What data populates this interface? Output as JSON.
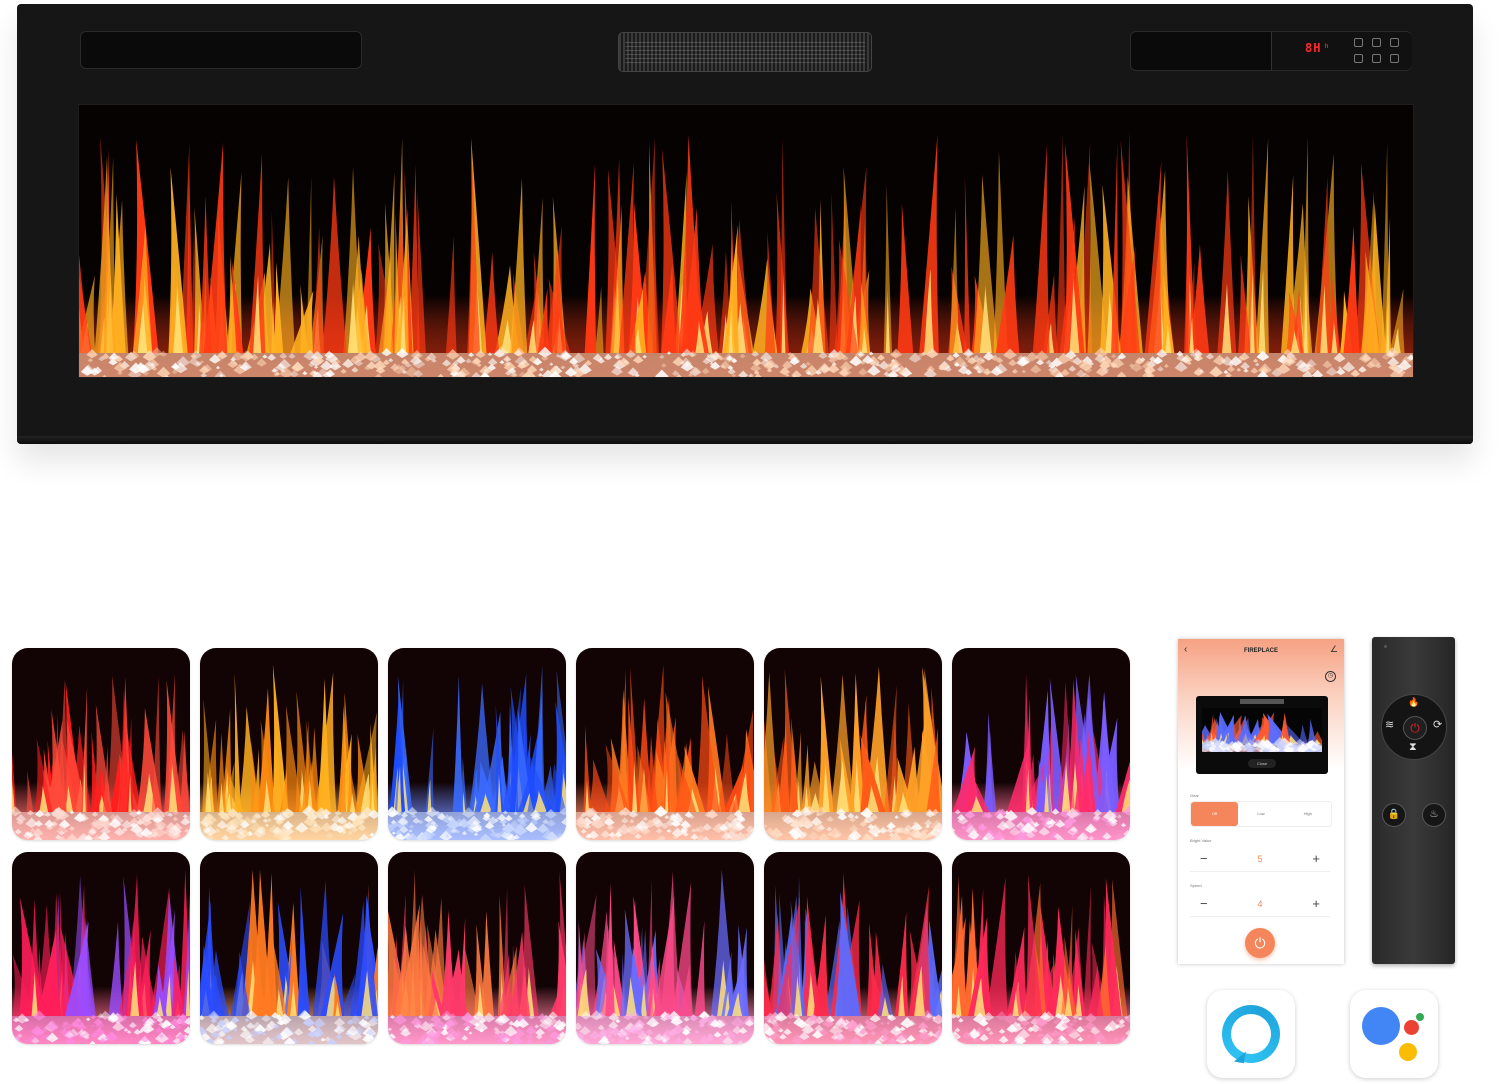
{
  "fireplace": {
    "display_text": "8H",
    "display_unit": "h",
    "flame_color": "#ff3a14"
  },
  "flame_presets": [
    {
      "glow": "#ff1e1e",
      "ember": "#ff4a3a",
      "bed": "#ffd9d0"
    },
    {
      "glow": "#ff8a10",
      "ember": "#ffb020",
      "bed": "#ffe6c0"
    },
    {
      "glow": "#1f4dff",
      "ember": "#3a6bff",
      "bed": "#c8d8ff"
    },
    {
      "glow": "#ff4a14",
      "ember": "#ff7a20",
      "bed": "#ffdccc"
    },
    {
      "glow": "#ff5a18",
      "ember": "#ffa028",
      "bed": "#ffe0c8"
    },
    {
      "glow": "#ff2a6a",
      "ember": "#7a5cff",
      "bed": "#ff9ae0"
    },
    {
      "glow": "#ff1e5a",
      "ember": "#9a4cff",
      "bed": "#ff8ae0"
    },
    {
      "glow": "#ff7a20",
      "ember": "#2a4cff",
      "bed": "#c8d0ff"
    },
    {
      "glow": "#ff3a6a",
      "ember": "#ff7a40",
      "bed": "#ff9ae0"
    },
    {
      "glow": "#ff4a8a",
      "ember": "#6a6cff",
      "bed": "#ffb0e8"
    },
    {
      "glow": "#ff2a4a",
      "ember": "#5a6cff",
      "bed": "#ffa0d0"
    },
    {
      "glow": "#ff2a5a",
      "ember": "#ff6a30",
      "bed": "#ff9ac8"
    }
  ],
  "app": {
    "title": "FIREPLACE",
    "back_icon": "‹",
    "edit_icon": "∠",
    "timer_icon": "◷",
    "preview_chip": "Close",
    "gear_label": "Gear",
    "gear_options": [
      "Off",
      "Low",
      "High"
    ],
    "gear_active": "Off",
    "bright_label": "Bright Value",
    "bright_value": "5",
    "speed_label": "Speed",
    "speed_value": "4",
    "minus_glyph": "−",
    "plus_glyph": "+",
    "power_icon": "⏻",
    "accent": "#f5855a"
  },
  "remote": {
    "flame_icon": "🔥",
    "heat_icon": "≋",
    "power_icon": "⏻",
    "light_icon": "⟳",
    "timer_icon": "⧗",
    "lock_icon": "🔒",
    "fire_icon": "♨"
  },
  "logos": {
    "alexa": "alexa-icon",
    "google": "google-assistant-icon",
    "google_colors": [
      "#4285f4",
      "#ea4335",
      "#fbbc04",
      "#34a853"
    ]
  }
}
